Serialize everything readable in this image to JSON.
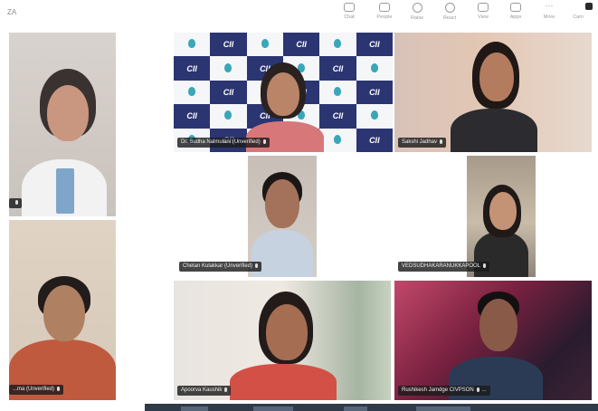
{
  "window": {
    "top_left_text": "ZA"
  },
  "toolbar": {
    "buttons": [
      {
        "label": "Chat",
        "icon": "chat-icon"
      },
      {
        "label": "People",
        "icon": "people-icon"
      },
      {
        "label": "Raise",
        "icon": "raise-hand-icon"
      },
      {
        "label": "React",
        "icon": "react-icon"
      },
      {
        "label": "View",
        "icon": "view-icon"
      },
      {
        "label": "Apps",
        "icon": "apps-icon"
      },
      {
        "label": "More",
        "icon": "more-icon"
      },
      {
        "label": "Cam",
        "icon": "camera-icon"
      }
    ]
  },
  "background_logo_text": "CII",
  "participants": [
    {
      "name": "",
      "muted": true
    },
    {
      "name": "Dr. Sudha Nalmulani (Unverified)",
      "muted": true
    },
    {
      "name": "Sakshi Jadhav",
      "muted": true
    },
    {
      "name": "Chetan Kulakkar (Unverified)",
      "muted": true
    },
    {
      "name": "VEDSUDHAKARANUKKAPOOL",
      "muted": true
    },
    {
      "name": "...ma (Unverified)",
      "muted": true
    },
    {
      "name": "Apoorva Kaushik",
      "muted": true
    },
    {
      "name": "Rushikesh Jamdge CIVPSON",
      "muted": true,
      "extra": "..."
    }
  ],
  "colors": {
    "tag_bg": "#1c1c1c",
    "cii_navy": "#2b3572",
    "cii_teal": "#3aa6b8"
  }
}
